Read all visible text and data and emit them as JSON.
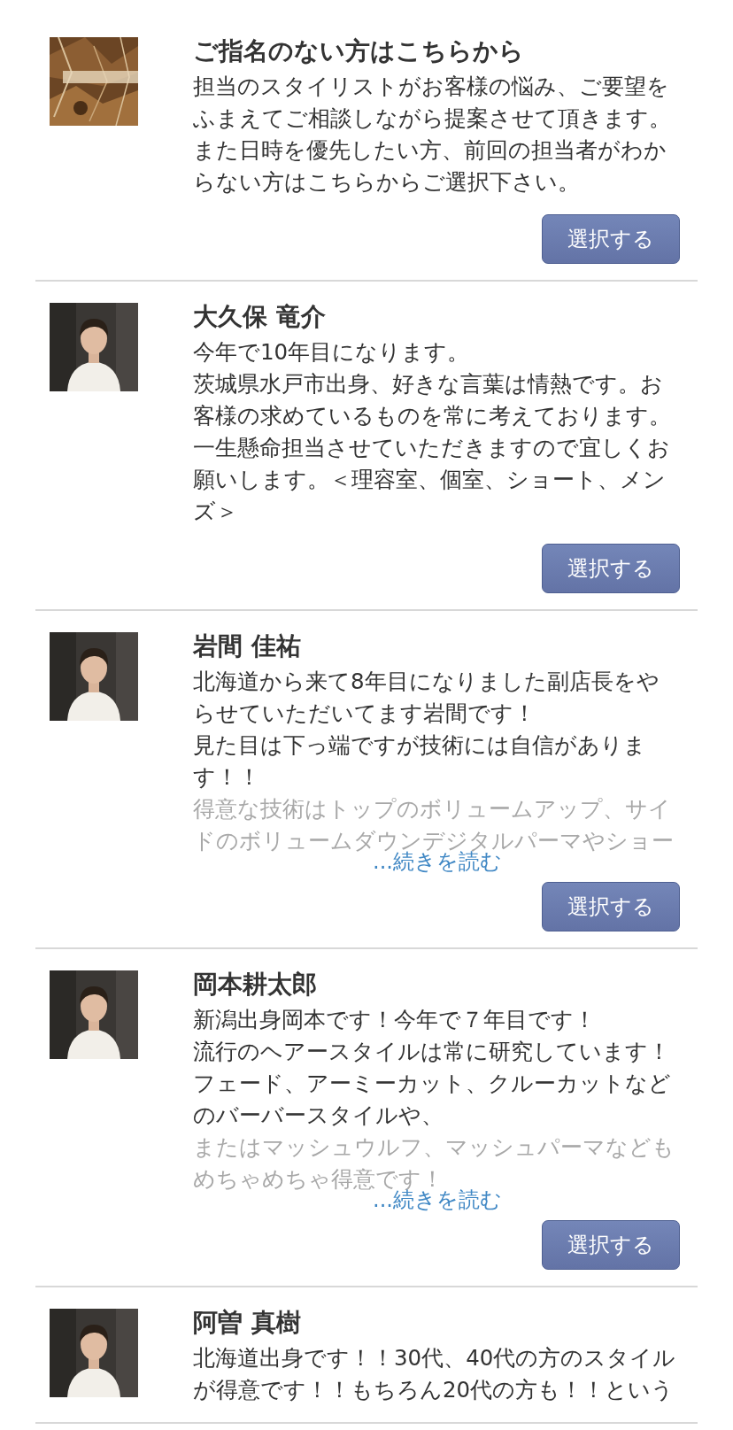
{
  "stylists": [
    {
      "kind": "salon",
      "name": "ご指名のない方はこちらから",
      "bio": [
        "担当のスタイリストがお客様の悩み、ご要望をふまえてご相談しながら提案させて頂きます。また日時を優先したい方、前回の担当者がわからない方はこちらからご選択下さい。"
      ],
      "button": "選択する"
    },
    {
      "kind": "person",
      "name": "大久保 竜介",
      "bio": [
        "今年で10年目になります。",
        "茨城県水戸市出身、好きな言葉は情熱です。お客様の求めているものを常に考えております。一生懸命担当させていただきますので宜しくお願いします。＜理容室、個室、ショート、メンズ＞"
      ],
      "button": "選択する"
    },
    {
      "kind": "person",
      "name": "岩間 佳祐",
      "bio": [
        "北海道から来て8年目になりました副店長をやらせていただいてます岩間です！",
        "見た目は下っ端ですが技術には自信があります！！"
      ],
      "faded": "得意な技術はトップのボリュームアップ、サイドのボリュームダウンデジタルパーマやショー",
      "more_link": "...続きを読む",
      "button": "選択する"
    },
    {
      "kind": "person",
      "name": "岡本耕太郎",
      "bio": [
        "新潟出身岡本です！今年で７年目です！",
        "流行のヘアースタイルは常に研究しています！",
        "フェード、アーミーカット、クルーカットなどのバーバースタイルや、"
      ],
      "faded": "またはマッシュウルフ、マッシュパーマなどもめちゃめちゃ得意です！",
      "more_link": "...続きを読む",
      "button": "選択する"
    },
    {
      "kind": "person",
      "name": "阿曽 真樹",
      "bio": [
        "北海道出身です！！30代、40代の方のスタイルが得意です！！もちろん20代の方も！！という"
      ]
    }
  ]
}
